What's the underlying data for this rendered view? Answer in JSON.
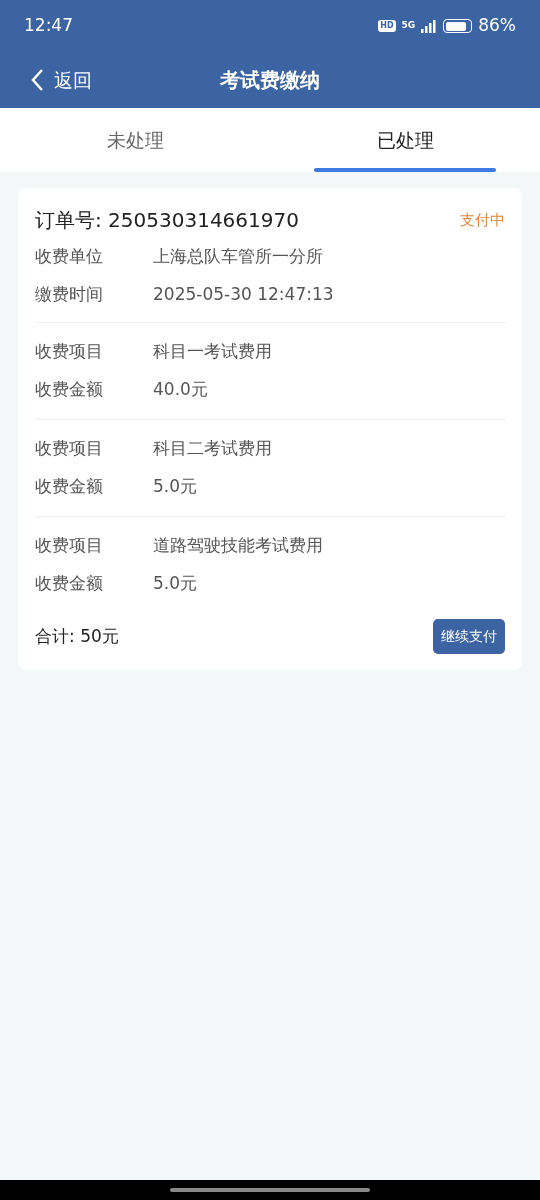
{
  "status_bar": {
    "time": "12:47",
    "hd": "HD",
    "network": "5G",
    "battery": "86%"
  },
  "nav": {
    "back": "返回",
    "title": "考试费缴纳"
  },
  "tabs": [
    {
      "label": "未处理",
      "selected": false
    },
    {
      "label": "已处理",
      "selected": true
    }
  ],
  "orders": [
    {
      "order_no": "订单号: 250530314661970",
      "status": "支付中",
      "info": [
        {
          "label": "收费单位",
          "value": "上海总队车管所一分所"
        },
        {
          "label": "缴费时间",
          "value": "2025-05-30 12:47:13"
        }
      ],
      "items": [
        [
          {
            "label": "收费项目",
            "value": "科目一考试费用"
          },
          {
            "label": "收费金额",
            "value": "40.0元"
          }
        ],
        [
          {
            "label": "收费项目",
            "value": "科目二考试费用"
          },
          {
            "label": "收费金额",
            "value": "5.0元"
          }
        ],
        [
          {
            "label": "收费项目",
            "value": "道路驾驶技能考试费用"
          },
          {
            "label": "收费金额",
            "value": "5.0元"
          }
        ]
      ],
      "total": "合计: 50元",
      "action": "继续支付"
    }
  ]
}
